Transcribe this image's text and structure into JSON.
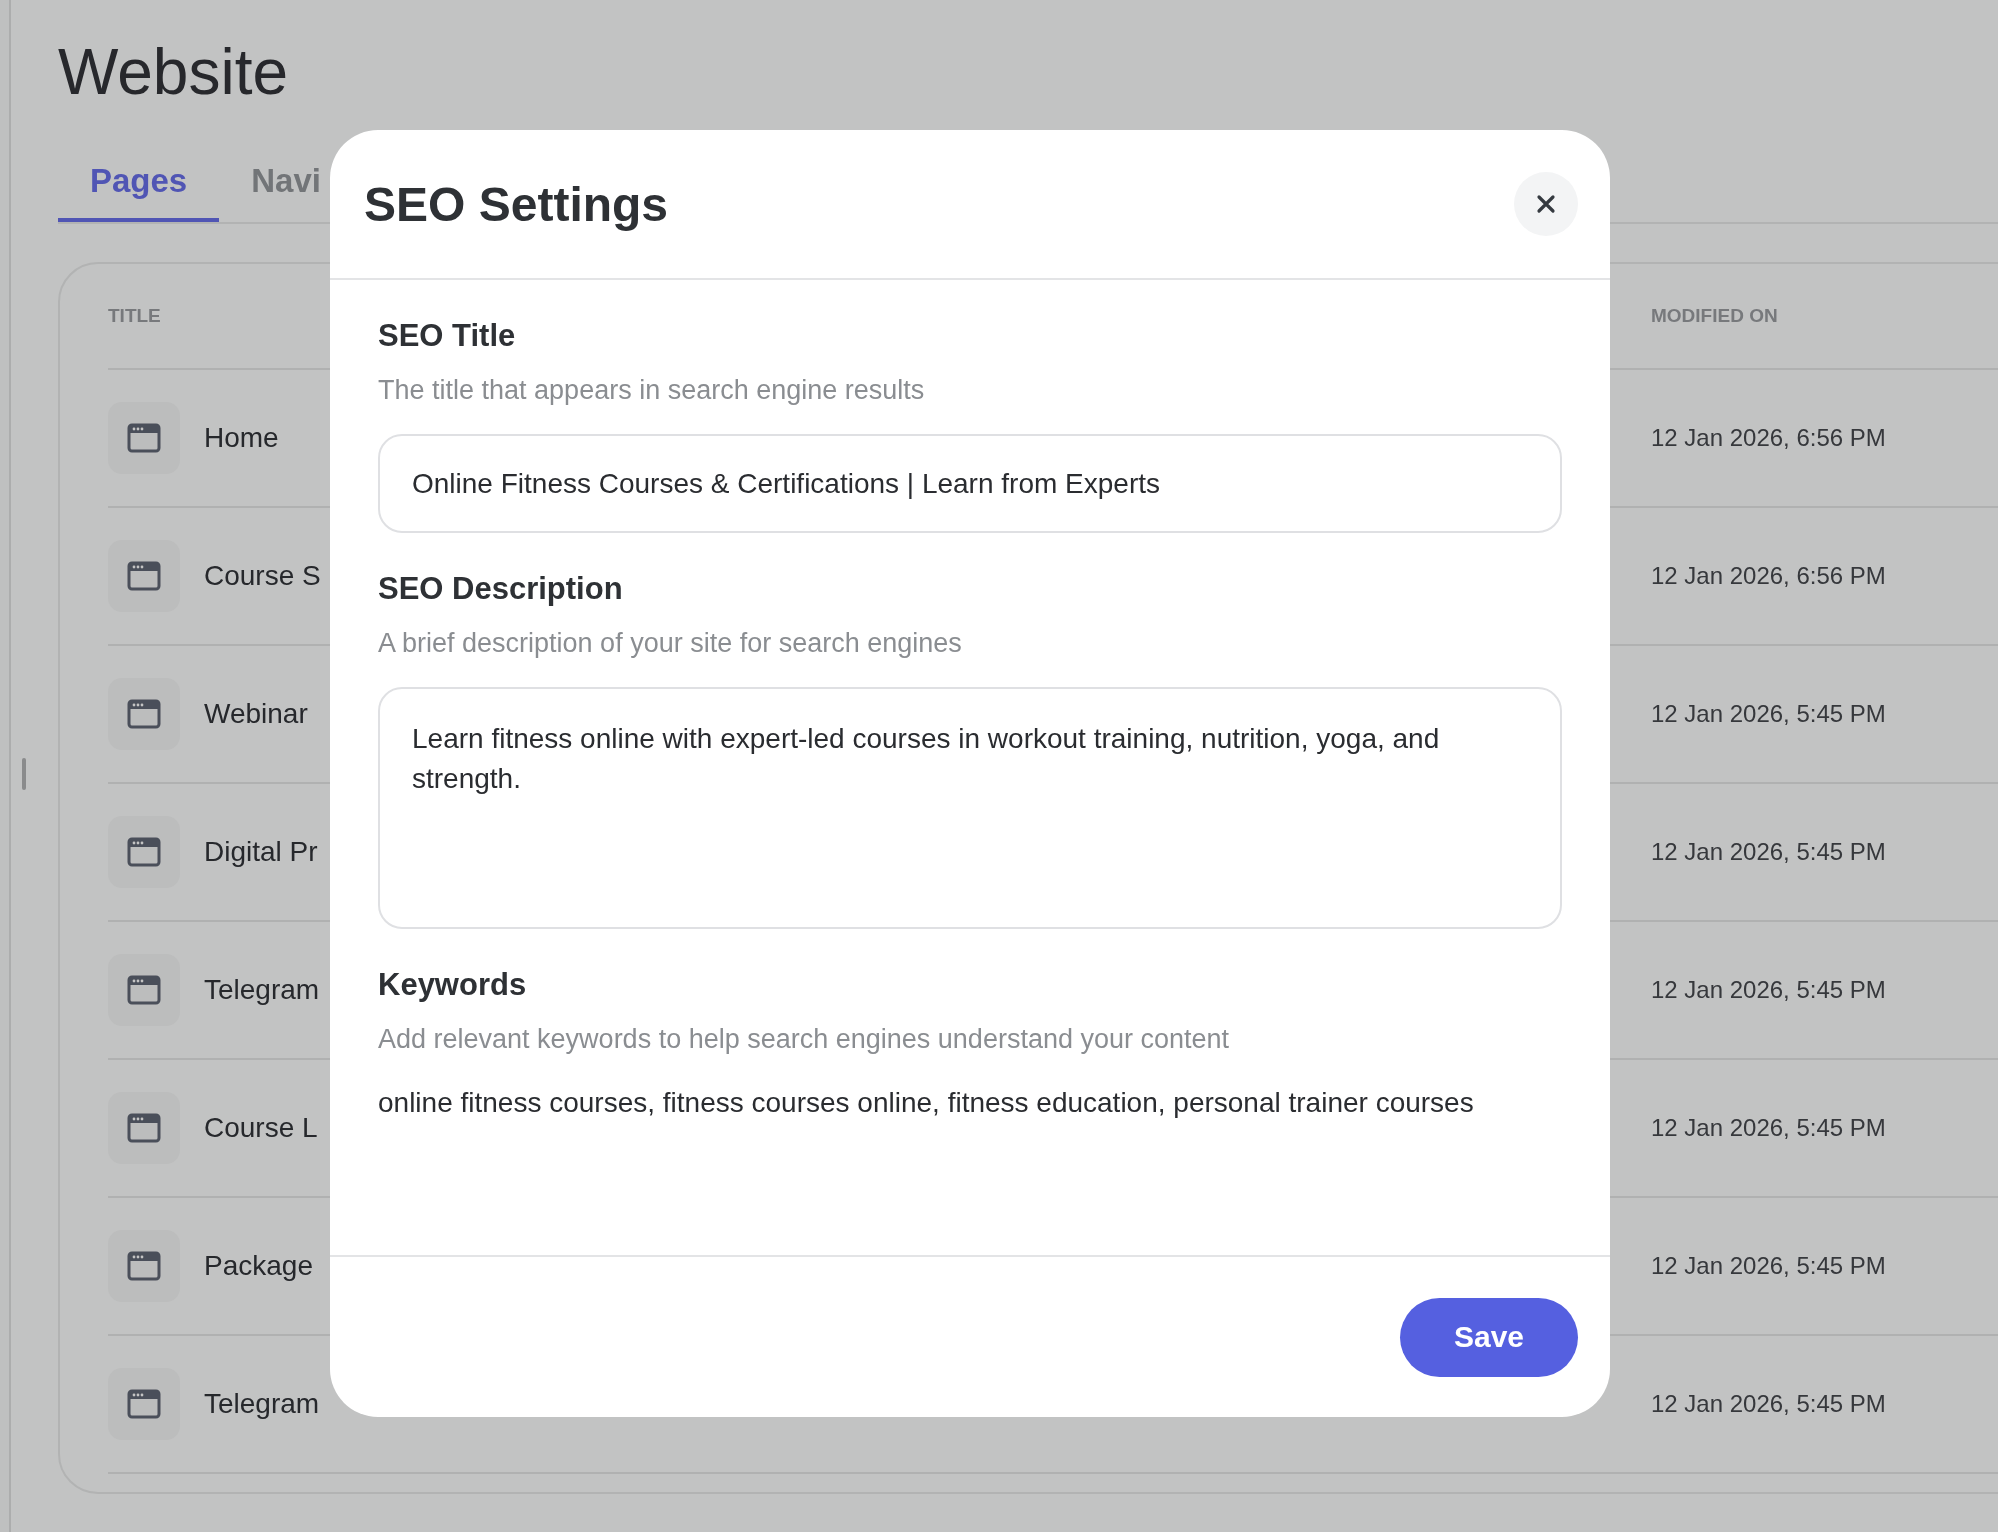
{
  "page": {
    "title": "Website",
    "tabs": [
      {
        "label": "Pages",
        "selected": true
      },
      {
        "label": "Navi",
        "selected": false
      }
    ],
    "table": {
      "columns": [
        "TITLE",
        "MODIFIED ON"
      ],
      "rows": [
        {
          "title": "Home",
          "modified_on": "12 Jan 2026, 6:56 PM"
        },
        {
          "title": "Course S",
          "modified_on": "12 Jan 2026, 6:56 PM"
        },
        {
          "title": "Webinar",
          "modified_on": "12 Jan 2026, 5:45 PM"
        },
        {
          "title": "Digital Pr",
          "modified_on": "12 Jan 2026, 5:45 PM"
        },
        {
          "title": "Telegram",
          "modified_on": "12 Jan 2026, 5:45 PM"
        },
        {
          "title": "Course L",
          "modified_on": "12 Jan 2026, 5:45 PM"
        },
        {
          "title": "Package",
          "modified_on": "12 Jan 2026, 5:45 PM"
        },
        {
          "title": "Telegram",
          "modified_on": "12 Jan 2026, 5:45 PM"
        }
      ]
    }
  },
  "modal": {
    "title": "SEO Settings",
    "fields": [
      {
        "kind": "input",
        "label": "SEO Title",
        "help": "The title that appears in search engine results",
        "value": "Online Fitness Courses & Certifications | Learn from Experts"
      },
      {
        "kind": "textarea",
        "label": "SEO Description",
        "help": "A brief description of your site for search engines",
        "value": "Learn fitness online with expert-led courses in workout training, nutrition, yoga, and strength."
      },
      {
        "kind": "text",
        "label": "Keywords",
        "help": "Add relevant keywords to help search engines understand your content",
        "value": "online fitness courses, fitness courses online, fitness education, personal trainer courses"
      }
    ],
    "save_button": "Save"
  }
}
